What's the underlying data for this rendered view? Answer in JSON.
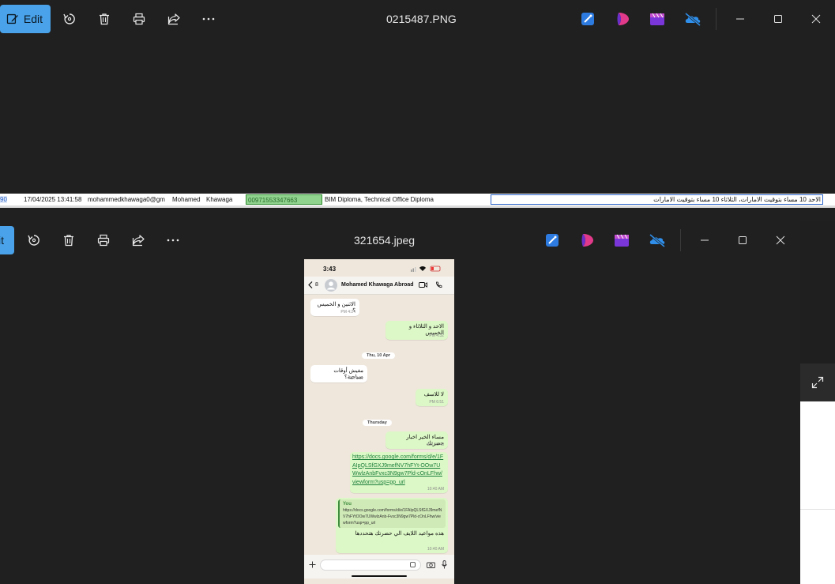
{
  "back_window": {
    "toolbar": {
      "edit_label": "Edit",
      "title": "0215487.PNG"
    },
    "sheet_row": {
      "row_num": "90",
      "timestamp": "17/04/2025 13:41:58",
      "email": "mohammedkhawaga0@gm",
      "first_name": "Mohamed",
      "last_name": "Khawaga",
      "phone": "00971553347663",
      "courses": "BIM Diploma, Technical Office Diploma",
      "availability": "الاحد 10 مساء بتوقيت الامارات، الثلاثاء 10 مساء بتوقيت الامارات"
    }
  },
  "front_window": {
    "toolbar": {
      "edit_label": "it",
      "title": "321654.jpeg"
    },
    "photo": {
      "status_time": "3:43",
      "back_count": "8",
      "contact_name": "Mohamed Khawaga Abroad",
      "messages": [
        {
          "dir": "in",
          "text": "الاثنين و الخميس ؟",
          "time": "4:24 PM"
        },
        {
          "dir": "out",
          "text": "الاحد و الثلاثاء و الخميس",
          "time": "4:32 PM"
        },
        {
          "dir": "chip",
          "text": "Thu, 10 Apr"
        },
        {
          "dir": "in",
          "text": "مفيش أوقات صباحية؟",
          "time": "6:51 PM"
        },
        {
          "dir": "out",
          "text": "لا للاسف",
          "time": "6:51 PM"
        },
        {
          "dir": "chip",
          "text": "Thursday"
        },
        {
          "dir": "out",
          "text": "مساء الخير اخبار حضرتك",
          "time": "10:40 AM"
        },
        {
          "dir": "out",
          "text": "https://docs.google.com/forms/d/e/1FAIpQLSfGXJ9mefNV7hFYt-OOw7UWwlzAnbFvxc3N9gw7Pld-cOnLFhw/viewform?usp=pp_url",
          "time": "10:40 AM"
        },
        {
          "dir": "out",
          "quote_author": "You",
          "quote_text": "https://docs.google.com/forms/d/e/1FAIpQLSfGXJ9mefNV7hFYtOOw7UWwlzAnb-Fvxc3N9gw7Pld-cOnLFhw/viewform?usp=pp_url",
          "text": "هذه مواعيد اللايف الي حضرتك هتحددها",
          "time": "10:40 AM"
        }
      ]
    }
  }
}
